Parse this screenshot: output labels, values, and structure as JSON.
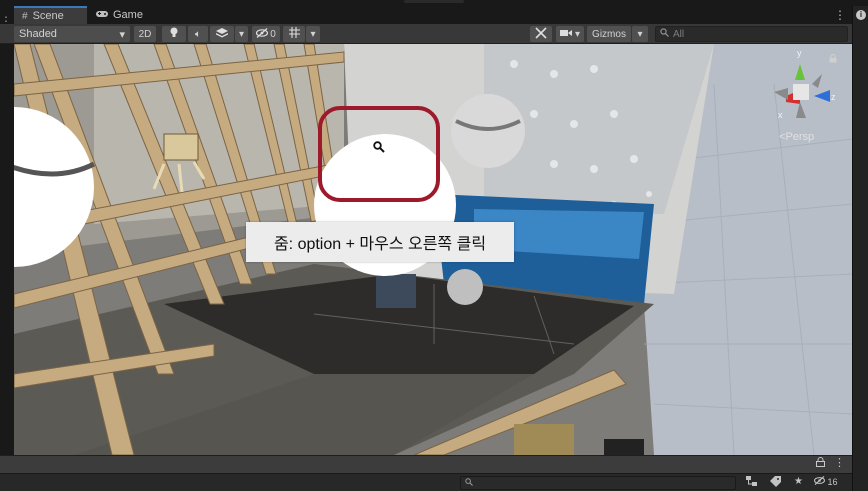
{
  "tabs": {
    "scene": "Scene",
    "game": "Game"
  },
  "toolbar": {
    "shading_mode": "Shaded",
    "toggle_2d": "2D",
    "hidden_count": "0",
    "gizmos_label": "Gizmos",
    "search_placeholder": "All"
  },
  "viewport": {
    "camera_mode": "Persp",
    "axis_x": "x",
    "axis_y": "y",
    "axis_z": "z",
    "tooltip": "줌: option + 마우스 오른쪽 클릭"
  },
  "status": {
    "hidden_count": "16"
  },
  "colors": {
    "highlight": "#9c1a2b",
    "tab_accent": "#3a79bb",
    "axis_x": "#d3302f",
    "axis_y": "#68c33a",
    "axis_z": "#2f6fd8"
  },
  "icons": [
    "scene-grid-icon",
    "gamepad-icon",
    "kebab-menu-icon",
    "chevron-down-icon",
    "lightbulb-icon",
    "speaker-icon",
    "layers-icon",
    "eye-slash-icon",
    "grid-icon",
    "tools-icon",
    "camera-icon",
    "search-icon",
    "magnifier-icon",
    "lock-icon",
    "hierarchy-icon",
    "tag-icon",
    "star-icon",
    "info-icon"
  ]
}
